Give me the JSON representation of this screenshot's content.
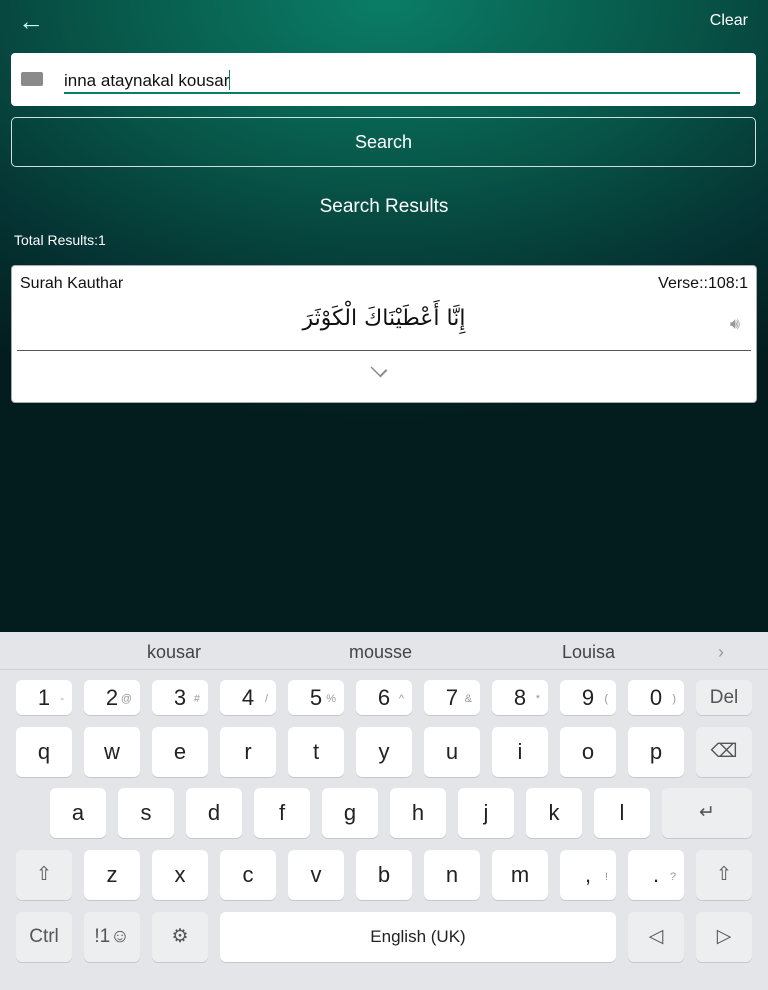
{
  "header": {
    "back_icon": "arrow-left",
    "clear_label": "Clear"
  },
  "search": {
    "value": "inna ataynakal kousar",
    "button_label": "Search"
  },
  "results": {
    "title": "Search Results",
    "total": "Total Results:1",
    "items": [
      {
        "surah": "Surah Kauthar",
        "verse": "Verse::108:1",
        "arabic": "إِنَّا أَعْطَيْنَاكَ الْكَوْثَرَ"
      }
    ]
  },
  "keyboard": {
    "suggestions": [
      "kousar",
      "mousse",
      "Louisa"
    ],
    "row1": [
      {
        "k": "1",
        "s": "-"
      },
      {
        "k": "2",
        "s": "@"
      },
      {
        "k": "3",
        "s": "#"
      },
      {
        "k": "4",
        "s": "/"
      },
      {
        "k": "5",
        "s": "%"
      },
      {
        "k": "6",
        "s": "^"
      },
      {
        "k": "7",
        "s": "&"
      },
      {
        "k": "8",
        "s": "*"
      },
      {
        "k": "9",
        "s": "("
      },
      {
        "k": "0",
        "s": ")"
      }
    ],
    "del": "Del",
    "row2": [
      "q",
      "w",
      "e",
      "r",
      "t",
      "y",
      "u",
      "i",
      "o",
      "p"
    ],
    "row3": [
      "a",
      "s",
      "d",
      "f",
      "g",
      "h",
      "j",
      "k",
      "l"
    ],
    "row4": [
      "z",
      "x",
      "c",
      "v",
      "b",
      "n",
      "m"
    ],
    "comma": {
      "k": ",",
      "s": "!"
    },
    "period": {
      "k": ".",
      "s": "?"
    },
    "ctrl": "Ctrl",
    "sym": "!1☺",
    "space": "English (UK)"
  }
}
